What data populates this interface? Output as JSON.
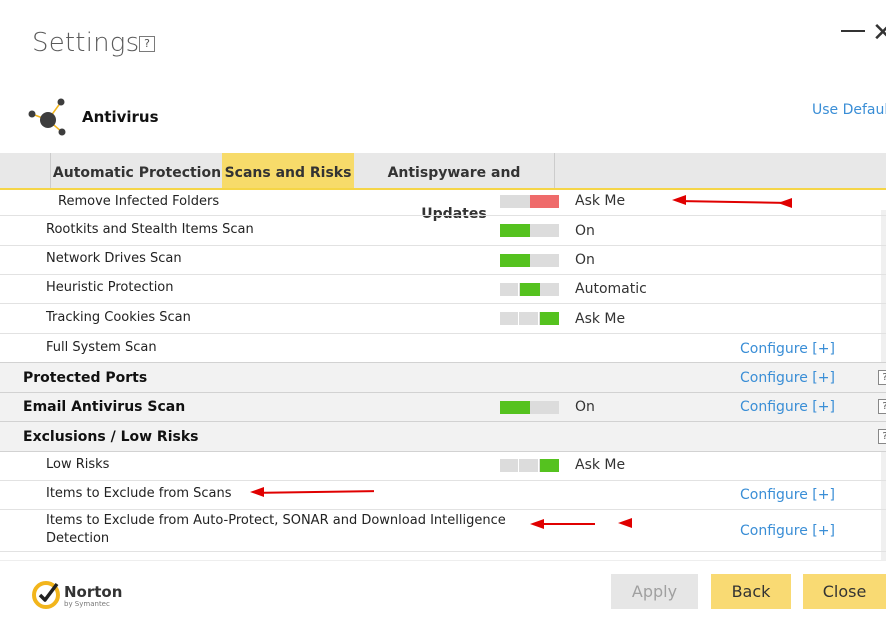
{
  "header": {
    "title": "Settings",
    "help": "?",
    "product": "Antivirus",
    "use_defaults": "Use Defaults"
  },
  "tabs": [
    {
      "label": "Automatic Protection",
      "active": false
    },
    {
      "label": "Scans and Risks",
      "active": true
    },
    {
      "label": "Antispyware and Updates",
      "active": false
    }
  ],
  "rows": [
    {
      "label": "Remove Infected Folders",
      "status": "Ask Me",
      "toggle": "red"
    },
    {
      "label": "Rootkits and Stealth Items Scan",
      "status": "On",
      "toggle": "on"
    },
    {
      "label": "Network Drives Scan",
      "status": "On",
      "toggle": "on"
    },
    {
      "label": "Heuristic Protection",
      "status": "Automatic",
      "toggle": "mid"
    },
    {
      "label": "Tracking Cookies Scan",
      "status": "Ask Me",
      "toggle": "right"
    },
    {
      "label": "Full System Scan",
      "configure": "Configure [+]"
    }
  ],
  "sections": {
    "protected_ports": {
      "label": "Protected Ports",
      "configure": "Configure [+]",
      "help": "?"
    },
    "email_scan": {
      "label": "Email Antivirus Scan",
      "status": "On",
      "toggle": "on",
      "configure": "Configure [+]",
      "help": "?"
    },
    "exclusions": {
      "label": "Exclusions / Low Risks",
      "help": "?"
    }
  },
  "exclusion_rows": [
    {
      "label": "Low Risks",
      "status": "Ask Me",
      "toggle": "right"
    },
    {
      "label": "Items to Exclude from Scans",
      "configure": "Configure [+]"
    },
    {
      "label": "Items to Exclude from Auto-Protect, SONAR and Download Intelligence",
      "label2": "Detection",
      "configure": "Configure [+]"
    }
  ],
  "footer": {
    "brand": "Norton",
    "brand_sub": "by Symantec",
    "apply": "Apply",
    "back": "Back",
    "close": "Close"
  },
  "colors": {
    "accent_yellow": "#f9da73",
    "toggle_green": "#55c21f",
    "toggle_red": "#ef6b6b",
    "link_blue": "#3a8ed6",
    "annotation_red": "#e00000"
  }
}
